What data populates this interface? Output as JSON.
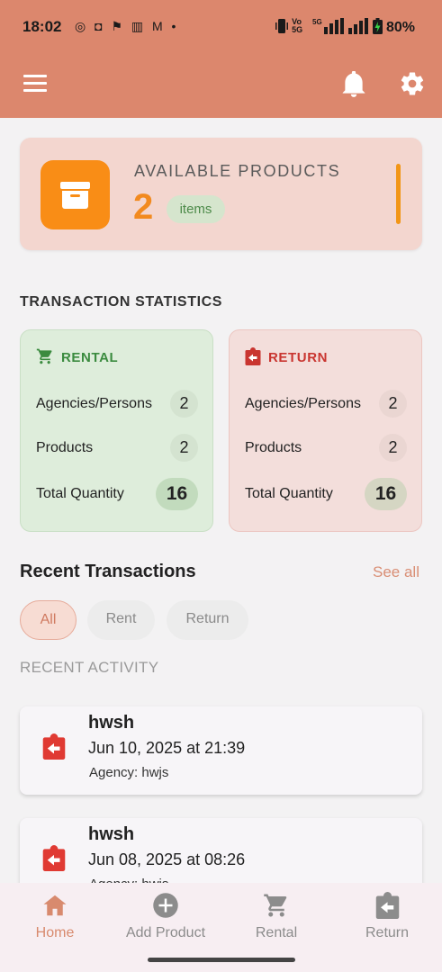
{
  "status_bar": {
    "time": "18:02",
    "notification_icons": "◎ ◘ ⚑ ▥ M •",
    "right": "▯ Vo 5G ⁴ᴳ▮▮▮ ▮▮▮ ▮ 80%",
    "battery": "80%"
  },
  "app_bar": {
    "menu_icon": "menu-icon",
    "bell_icon": "bell-icon",
    "settings_icon": "gear-icon",
    "color": "#dc876d"
  },
  "available_products": {
    "title": "AVAILABLE PRODUCTS",
    "count": "2",
    "unit": "items",
    "icon": "archive-box-icon",
    "accent_color": "#f98d16"
  },
  "transaction_statistics": {
    "title": "TRANSACTION STATISTICS",
    "rental": {
      "label": "RENTAL",
      "icon": "cart-icon",
      "rows": [
        {
          "label": "Agencies/Persons",
          "value": "2"
        },
        {
          "label": "Products",
          "value": "2"
        },
        {
          "label": "Total Quantity",
          "value": "16"
        }
      ]
    },
    "return": {
      "label": "RETURN",
      "icon": "clipboard-return-icon",
      "rows": [
        {
          "label": "Agencies/Persons",
          "value": "2"
        },
        {
          "label": "Products",
          "value": "2"
        },
        {
          "label": "Total Quantity",
          "value": "16"
        }
      ]
    }
  },
  "recent_transactions": {
    "title": "Recent Transactions",
    "see_all": "See all",
    "filters": [
      "All",
      "Rent",
      "Return"
    ],
    "selected_filter": "All",
    "activity_label": "RECENT ACTIVITY",
    "items": [
      {
        "name": "hwsh",
        "date": "Jun 10, 2025 at 21:39",
        "agency": "Agency: hwjs",
        "type": "return"
      },
      {
        "name": "hwsh",
        "date": "Jun 08, 2025 at 08:26",
        "agency": "Agency: hwjs",
        "type": "return"
      }
    ]
  },
  "bottom_nav": {
    "items": [
      {
        "label": "Home",
        "icon": "home-icon",
        "active": true
      },
      {
        "label": "Add Product",
        "icon": "add-circle-icon",
        "active": false
      },
      {
        "label": "Rental",
        "icon": "cart-icon",
        "active": false
      },
      {
        "label": "Return",
        "icon": "clipboard-return-icon",
        "active": false
      }
    ]
  }
}
